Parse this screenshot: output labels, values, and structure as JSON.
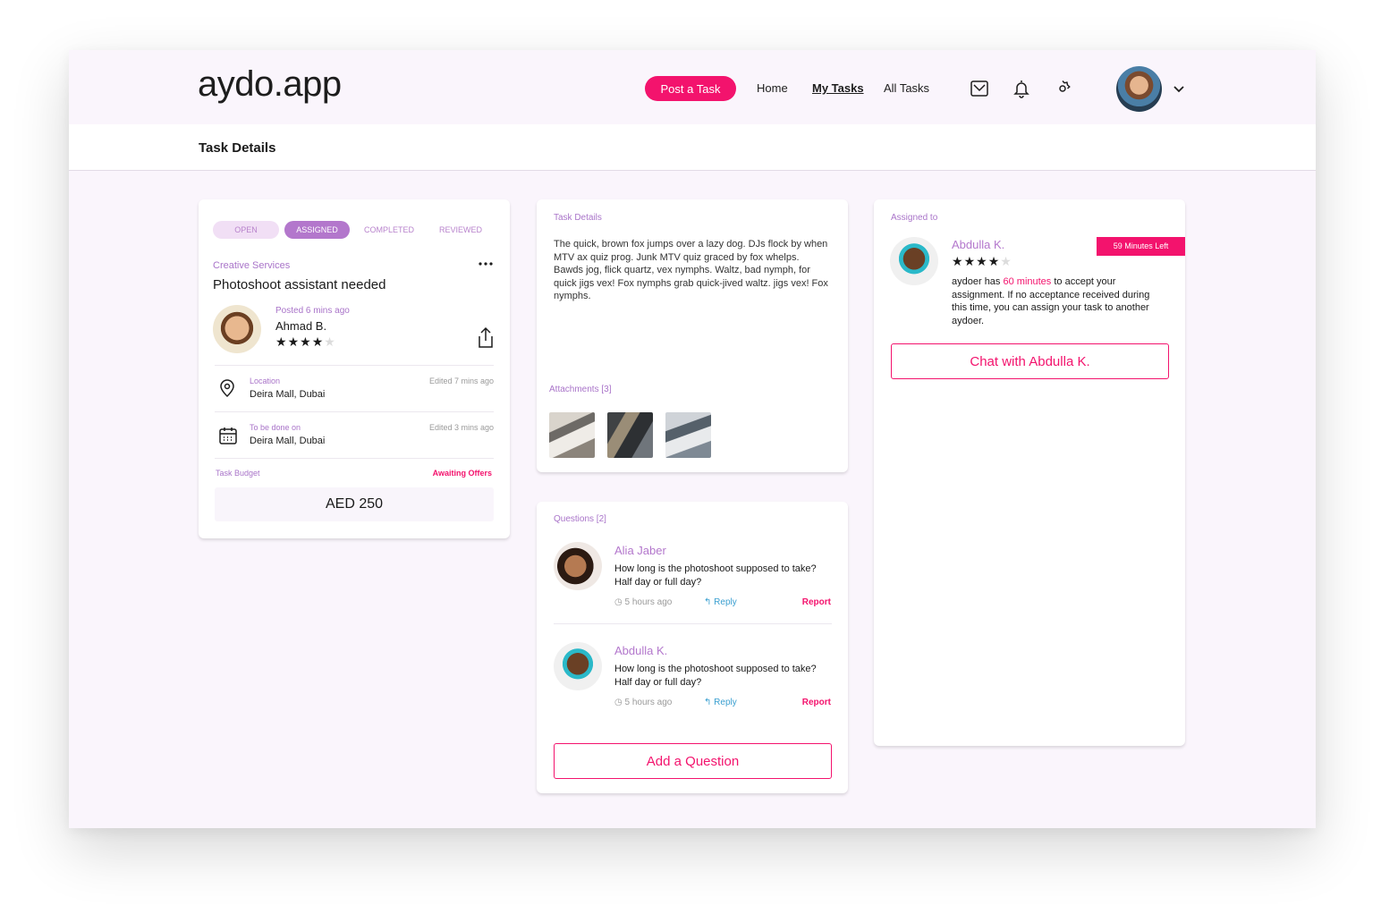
{
  "header": {
    "logo": "aydo.app",
    "post_task": "Post a Task",
    "nav": {
      "home": "Home",
      "my_tasks": "My Tasks",
      "all_tasks": "All Tasks"
    }
  },
  "subheader": {
    "title": "Task Details"
  },
  "task": {
    "statuses": [
      "OPEN",
      "ASSIGNED",
      "COMPLETED",
      "REVIEWED"
    ],
    "active_status": "ASSIGNED",
    "category": "Creative Services",
    "title": "Photoshoot assistant needed",
    "posted_ago": "Posted 6 mins ago",
    "poster_name": "Ahmad B.",
    "poster_rating": 4,
    "location": {
      "label": "Location",
      "value": "Deira Mall, Dubai",
      "edited": "Edited 7 mins ago"
    },
    "date": {
      "label": "To be done on",
      "value": "Deira Mall, Dubai",
      "edited": "Edited 3 mins ago"
    },
    "budget": {
      "label": "Task Budget",
      "status": "Awaiting Offers",
      "amount": "AED 250"
    }
  },
  "details": {
    "label": "Task Details",
    "text": "The quick, brown fox jumps over a lazy dog. DJs flock by when MTV ax quiz prog. Junk MTV quiz graced by fox whelps. Bawds jog, flick quartz, vex nymphs. Waltz, bad nymph, for quick jigs vex! Fox nymphs grab quick-jived waltz. jigs vex! Fox nymphs.",
    "attachments_label": "Attachments [3]"
  },
  "questions": {
    "label": "Questions [2]",
    "items": [
      {
        "name": "Alia Jaber",
        "text": "How long is the photoshoot supposed to take? Half day or full day?",
        "time": "5 hours ago",
        "reply": "Reply",
        "report": "Report"
      },
      {
        "name": "Abdulla K.",
        "text": "How long is the photoshoot supposed to take? Half day or full day?",
        "time": "5 hours ago",
        "reply": "Reply",
        "report": "Report"
      }
    ],
    "add_button": "Add a Question"
  },
  "assigned": {
    "label": "Assigned to",
    "name": "Abdulla K.",
    "timer": "59 Minutes Left",
    "rating": 4,
    "text_pre": "aydoer has ",
    "text_highlight": "60 minutes",
    "text_post": " to accept your assignment. If no acceptance received during this time, you can assign your task to another aydoer.",
    "chat_button": "Chat with Abdulla K."
  },
  "colors": {
    "accent": "#f3136d",
    "purple": "#b377cc",
    "background": "#faf5fc"
  }
}
